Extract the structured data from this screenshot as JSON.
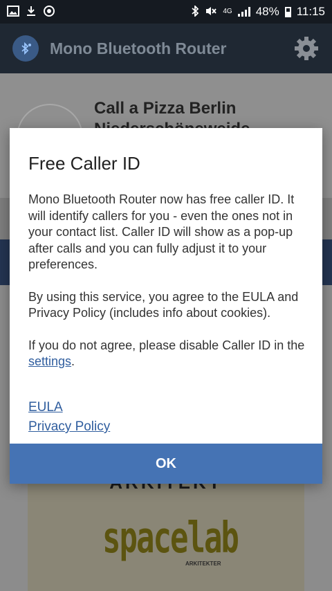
{
  "status_bar": {
    "left_icons": [
      "image-icon",
      "download-icon",
      "sync-icon"
    ],
    "right_icons": [
      "bluetooth-icon",
      "mute-icon"
    ],
    "network": "4G",
    "battery": "48%",
    "time": "11:15"
  },
  "app_bar": {
    "title": "Mono Bluetooth Router",
    "logo_icon": "bluetooth-music-icon",
    "settings_icon": "gear-icon"
  },
  "background": {
    "contact_name": "Call a Pizza Berlin Niederschöneweide",
    "image_header": "ARKITEKT",
    "image_brand": "spacelab",
    "image_sub": "ARKITEKTER"
  },
  "dialog": {
    "title": "Free Caller ID",
    "paragraph1": "Mono Bluetooth Router now has free caller ID. It will identify callers for you - even the ones not in your contact list. Caller ID will show as a pop-up after calls and you can fully adjust it to your preferences.",
    "paragraph2": "By using this service, you agree to the EULA and Privacy Policy (includes info about cookies).",
    "paragraph3_prefix": "If you do not agree, please disable Caller ID in the ",
    "paragraph3_link": "settings",
    "paragraph3_suffix": ".",
    "eula_link": "EULA",
    "privacy_link": "Privacy Policy",
    "ok_label": "OK"
  },
  "colors": {
    "status_bar": "#151a21",
    "app_bar": "#1f2833",
    "button": "#4573b4",
    "link": "#2f5d9e"
  }
}
